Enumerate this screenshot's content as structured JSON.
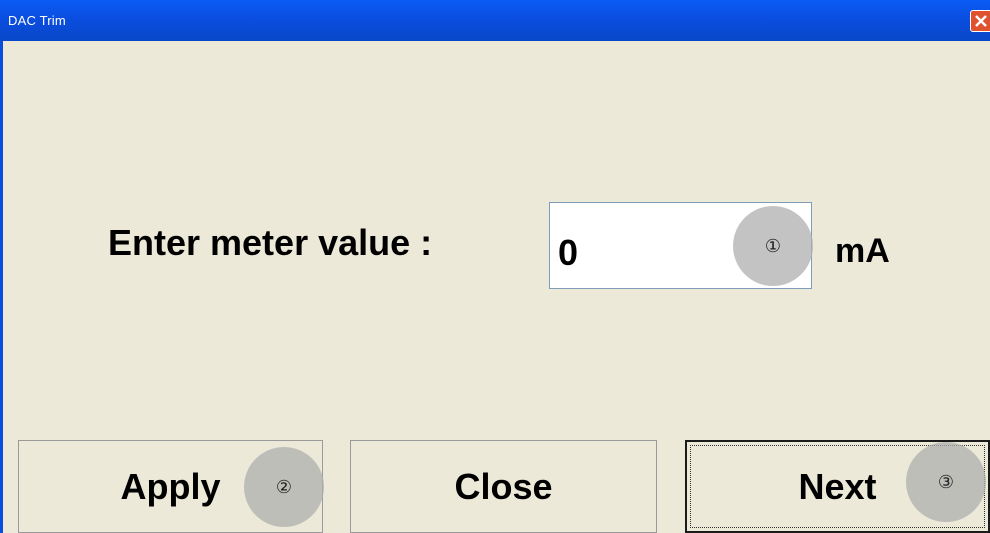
{
  "window": {
    "title": "DAC Trim",
    "close_glyph": "close-icon"
  },
  "form": {
    "prompt_label": "Enter meter value :",
    "meter_value": "0",
    "unit": "mA"
  },
  "markers": {
    "m1": "①",
    "m2": "②",
    "m3": "③"
  },
  "buttons": {
    "apply_label": "Apply",
    "close_label": "Close",
    "next_label": "Next"
  },
  "colors": {
    "dialog_background": "#ece9d8",
    "titlebar": "#0a4ee0",
    "close_button": "#e0512d"
  }
}
